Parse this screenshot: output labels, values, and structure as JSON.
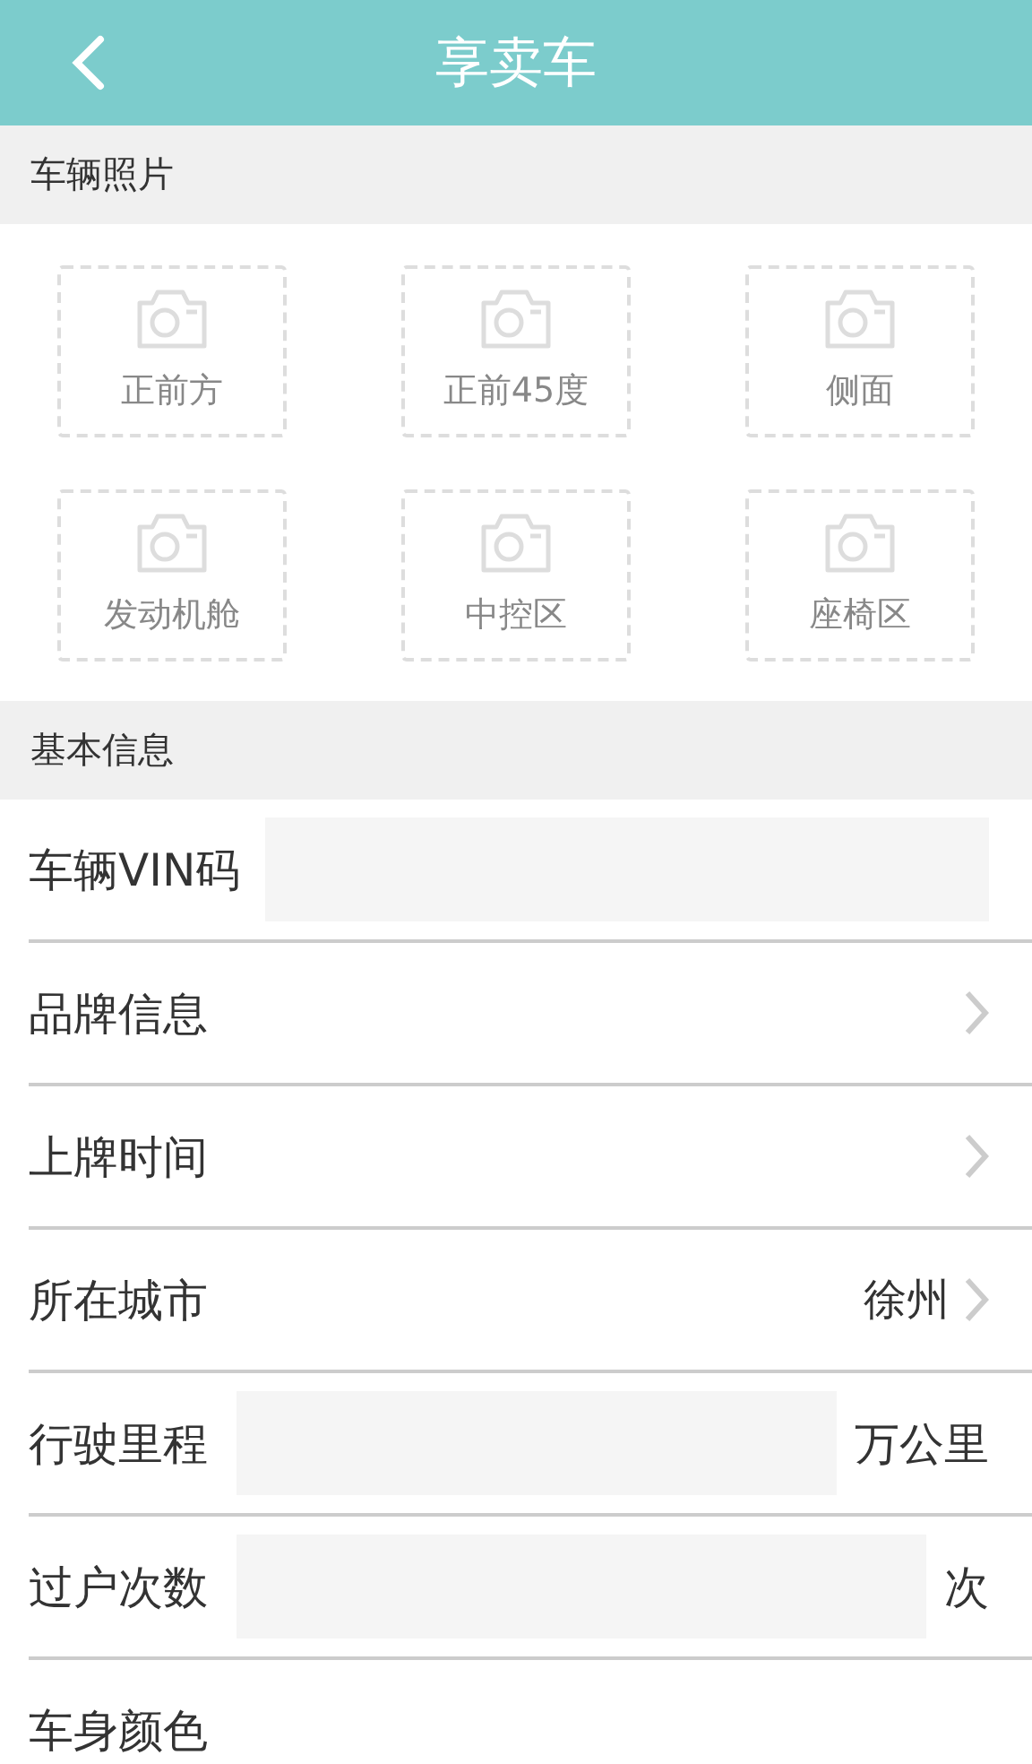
{
  "header": {
    "title": "享卖车"
  },
  "photo_section": {
    "title": "车辆照片",
    "slots": [
      {
        "label": "正前方"
      },
      {
        "label": "正前45度"
      },
      {
        "label": "侧面"
      },
      {
        "label": "发动机舱"
      },
      {
        "label": "中控区"
      },
      {
        "label": "座椅区"
      }
    ]
  },
  "info_section": {
    "title": "基本信息",
    "rows": [
      {
        "kind": "input",
        "label": "车辆VIN码"
      },
      {
        "kind": "select",
        "label": "品牌信息"
      },
      {
        "kind": "select",
        "label": "上牌时间"
      },
      {
        "kind": "select",
        "label": "所在城市",
        "value": "徐州"
      },
      {
        "kind": "input",
        "label": "行驶里程",
        "unit": "万公里"
      },
      {
        "kind": "input",
        "label": "过户次数",
        "unit": "次"
      },
      {
        "kind": "plain",
        "label": "车身颜色"
      }
    ]
  }
}
